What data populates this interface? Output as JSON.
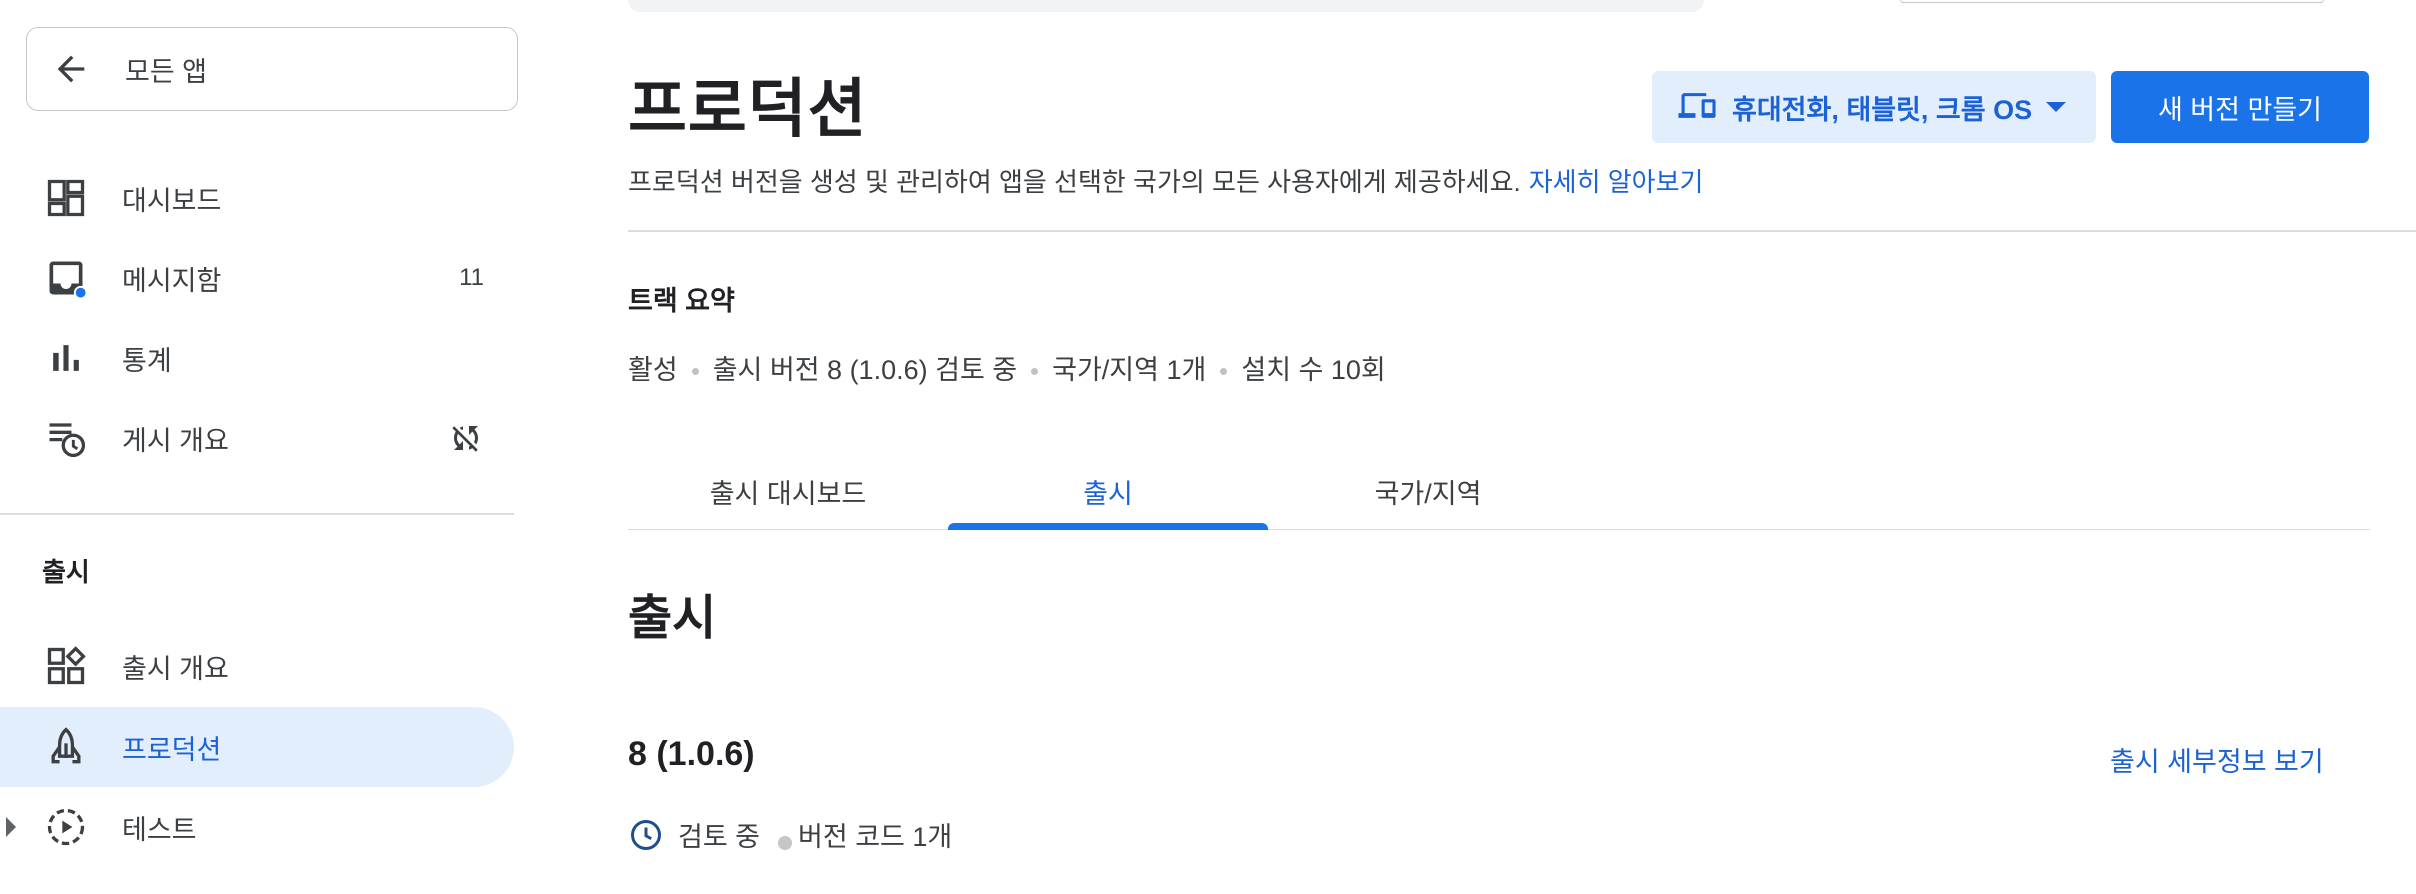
{
  "sidebar": {
    "back_label": "모든 앱",
    "items": [
      {
        "label": "대시보드"
      },
      {
        "label": "메시지함",
        "badge": "11"
      },
      {
        "label": "통계"
      },
      {
        "label": "게시 개요"
      }
    ],
    "section_label": "출시",
    "release_items": [
      {
        "label": "출시 개요"
      },
      {
        "label": "프로덕션"
      },
      {
        "label": "테스트"
      }
    ]
  },
  "page": {
    "title": "프로덕션",
    "description": "프로덕션 버전을 생성 및 관리하여 앱을 선택한 국가의 모든 사용자에게 제공하세요.",
    "learn_more": "자세히 알아보기",
    "device_selector": "휴대전화, 태블릿, 크롬 OS",
    "create_button": "새 버전 만들기"
  },
  "track": {
    "title": "트랙 요약",
    "summary": [
      "활성",
      "출시 버전 8 (1.0.6) 검토 중",
      "국가/지역 1개",
      "설치 수 10회"
    ]
  },
  "tabs": [
    {
      "label": "출시 대시보드"
    },
    {
      "label": "출시"
    },
    {
      "label": "국가/지역"
    }
  ],
  "release_section": {
    "title": "출시",
    "release_name": "8 (1.0.6)",
    "details_link": "출시 세부정보 보기",
    "status": "검토 중",
    "version_codes": "버전 코드 1개"
  },
  "icons": {
    "back": "arrow-left-icon",
    "dashboard": "dashboard-icon",
    "inbox": "inbox-icon",
    "stats": "bar-chart-icon",
    "publishing": "schedule-list-icon",
    "sync_off": "sync-disabled-icon",
    "release_overview": "widgets-icon",
    "production": "rocket-icon",
    "testing": "play-circle-dashed-icon",
    "devices": "devices-icon",
    "clock": "clock-icon"
  },
  "colors": {
    "accent": "#1a73e8",
    "accent_text": "#1a62d6",
    "active_bg": "#e3eefc",
    "notification_dot": "#1a73e8"
  }
}
